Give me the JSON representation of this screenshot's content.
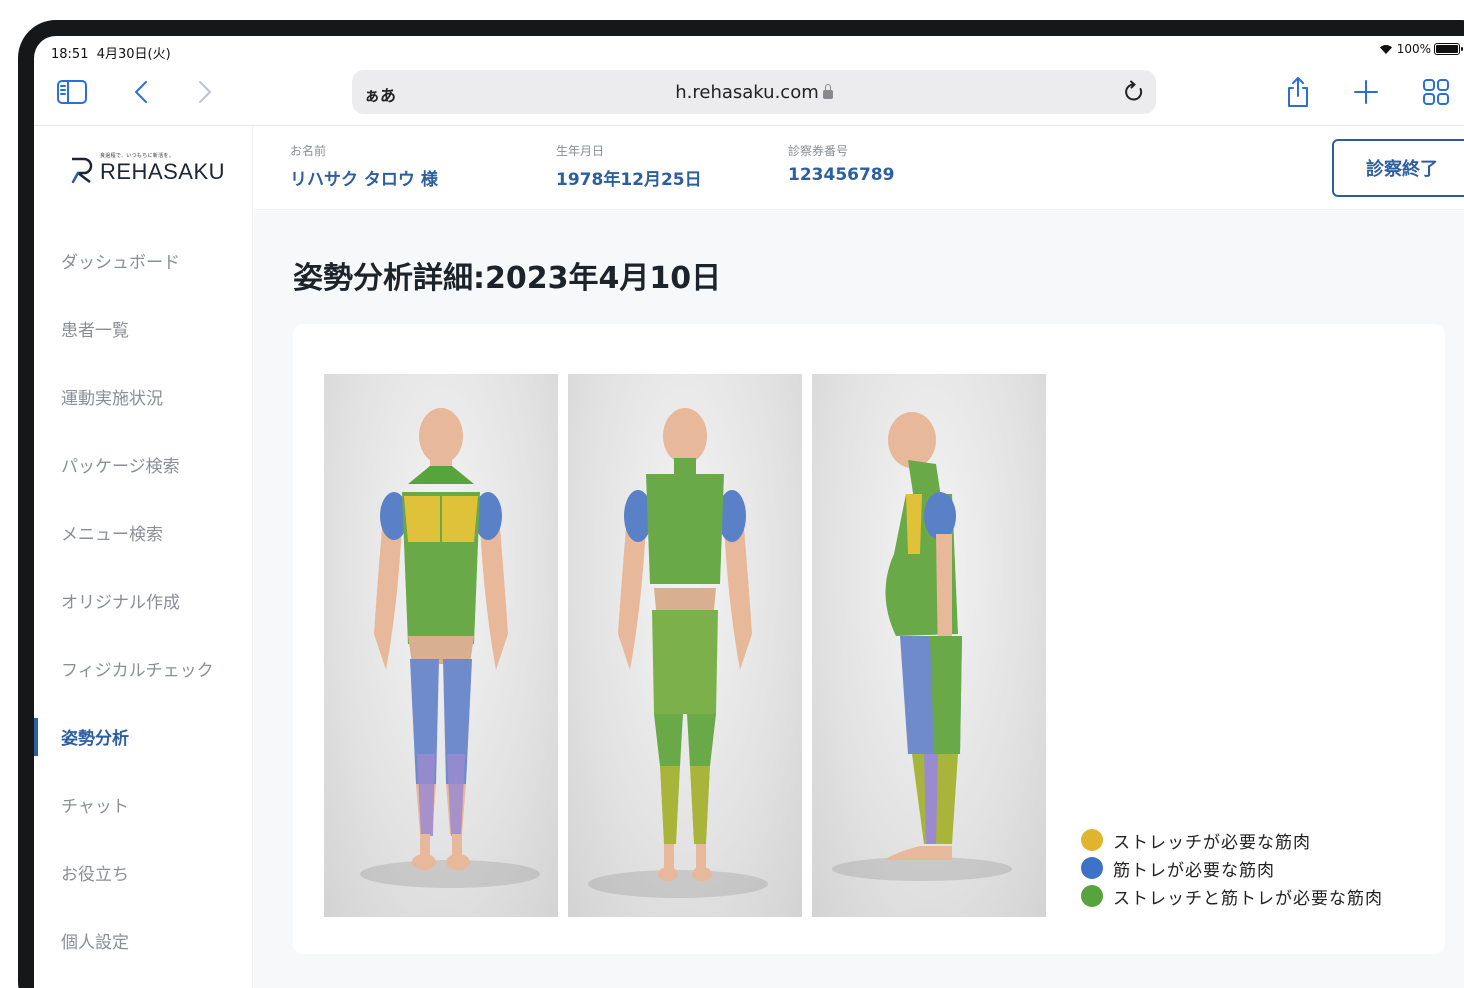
{
  "status_bar": {
    "time": "18:51",
    "date": "4月30日(火)",
    "battery": "100%"
  },
  "browser": {
    "aa_label": "ぁあ",
    "url": "h.rehasaku.com",
    "icons": [
      "sidebar-icon",
      "back-icon",
      "forward-icon",
      "reload-icon",
      "share-icon",
      "new-tab-icon",
      "tabs-icon"
    ]
  },
  "logo": {
    "tagline": "良過程で、いつもちに新活を。",
    "name": "REHASAKU"
  },
  "sidebar": {
    "items": [
      {
        "label": "ダッシュボード",
        "active": false
      },
      {
        "label": "患者一覧",
        "active": false
      },
      {
        "label": "運動実施状況",
        "active": false
      },
      {
        "label": "パッケージ検索",
        "active": false
      },
      {
        "label": "メニュー検索",
        "active": false
      },
      {
        "label": "オリジナル作成",
        "active": false
      },
      {
        "label": "フィジカルチェック",
        "active": false
      },
      {
        "label": "姿勢分析",
        "active": true
      },
      {
        "label": "チャット",
        "active": false
      },
      {
        "label": "お役立ち",
        "active": false
      },
      {
        "label": "個人設定",
        "active": false
      }
    ]
  },
  "patient": {
    "name_label": "お名前",
    "name_value": "リハサク タロウ 様",
    "dob_label": "生年月日",
    "dob_value": "1978年12月25日",
    "card_label": "診察券番号",
    "card_value": "123456789"
  },
  "header": {
    "end_button": "診察終了"
  },
  "main": {
    "title": "姿勢分析詳細:2023年4月10日",
    "views": [
      "front",
      "back",
      "side"
    ]
  },
  "legend": [
    {
      "label": "ストレッチが必要な筋肉",
      "color": "#e0b52e"
    },
    {
      "label": "筋トレが必要な筋肉",
      "color": "#3c72c8"
    },
    {
      "label": "ストレッチと筋トレが必要な筋肉",
      "color": "#58a43c"
    }
  ],
  "colors": {
    "accent": "#2c5fa0",
    "skin": "#e8b89a"
  }
}
